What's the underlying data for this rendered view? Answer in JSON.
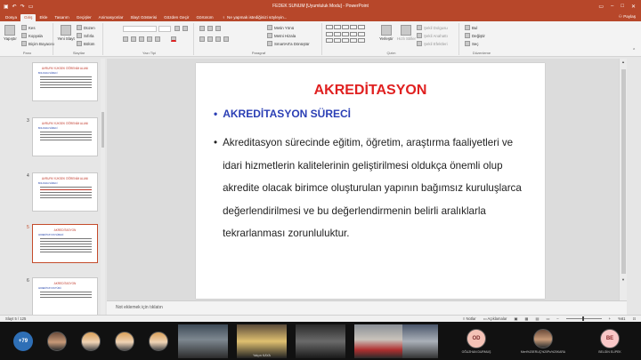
{
  "window": {
    "title": "FEDEK SUNUM [Uyumluluk Modu] - PowerPoint",
    "share_label": "Paylaş"
  },
  "tabs": [
    {
      "label": "Dosya"
    },
    {
      "label": "Giriş",
      "active": true
    },
    {
      "label": "Ekle"
    },
    {
      "label": "Tasarım"
    },
    {
      "label": "Geçişler"
    },
    {
      "label": "Animasyonlar"
    },
    {
      "label": "Slayt Gösterisi"
    },
    {
      "label": "Gözden Geçir"
    },
    {
      "label": "Görünüm"
    }
  ],
  "tell_me": "Ne yapmak istediğinizi söyleyin...",
  "ribbon": {
    "clipboard": {
      "cut": "Kes",
      "copy": "Kopyala",
      "paste": "Yapıştır",
      "format_painter": "Biçim Boyacısı",
      "label": "Pano"
    },
    "slides": {
      "new_slide": "Yeni Slayt",
      "layout": "Düzen",
      "reset": "Sıfırla",
      "section": "Bölüm",
      "label": "Slaytlar"
    },
    "font": {
      "label": "Yazı Tipi"
    },
    "paragraph": {
      "text_direction": "Metin Yönü",
      "align_text": "Metni Hizala",
      "smartart": "SmartArt'a Dönüştür",
      "label": "Paragraf"
    },
    "drawing": {
      "arrange": "Yerleştir",
      "quick_styles": "Hızlı Stiller",
      "shape_fill": "Şekil Dolgusu",
      "shape_outline": "Şekil Anahattı",
      "shape_effects": "Şekil Efektleri",
      "label": "Çizim"
    },
    "editing": {
      "find": "Bul",
      "replace": "Değiştir",
      "select": "Seç",
      "label": "Düzenleme"
    }
  },
  "thumbnails": [
    {
      "num": "",
      "title": "AVRUPA YÜKSEK ÖĞRENİM ALANI",
      "sub": "BOLOGNA SÜRECİ"
    },
    {
      "num": "3",
      "title": "AVRUPA YÜKSEK ÖĞRENİM ALANI",
      "sub": "BOLOGNA SÜRECİ"
    },
    {
      "num": "4",
      "title": "AVRUPA YÜKSEK ÖĞRENİM ALANI",
      "sub": "BOLOGNA SÜRECİ"
    },
    {
      "num": "5",
      "title": "AKREDİTASYON",
      "sub": "AKREDİTASYON SÜRECİ",
      "selected": true
    },
    {
      "num": "6",
      "title": "AKREDİTASYON",
      "sub": "AKREDİTASYON TÜRÜ"
    }
  ],
  "slide": {
    "title": "AKREDİTASYON",
    "subtitle": "AKREDİTASYON SÜRECİ",
    "body": "Akreditasyon sürecinde eğitim, öğretim, araştırma faaliyetleri ve idari hizmetlerin kalitelerinin geliştirilmesi oldukça önemli olup akredite olacak birimce oluşturulan yapının bağımsız kuruluşlarca değerlendirilmesi ve bu değerlendirmenin belirli aralıklarla tekrarlanması zorunluluktur.",
    "bullet": "•"
  },
  "notes_placeholder": "Not eklemek için tıklatın",
  "status": {
    "slide_info": "Slayt 5 / 125",
    "notes": "Notlar",
    "comments": "Açıklamalar",
    "zoom": "%61"
  },
  "participants": [
    {
      "label": "+79",
      "kind": "more"
    },
    {
      "label": "",
      "kind": "photo"
    },
    {
      "label": "",
      "kind": "photo2"
    },
    {
      "label": "",
      "kind": "photo2"
    },
    {
      "label": "",
      "kind": "photo2"
    },
    {
      "label": "",
      "kind": "video"
    },
    {
      "label": "Yalçın KAYA",
      "kind": "video"
    },
    {
      "label": "",
      "kind": "video"
    },
    {
      "label": "",
      "kind": "video"
    },
    {
      "label": "OD",
      "name": "OĞUZHAN DURMUŞ",
      "kind": "initials"
    },
    {
      "label": "",
      "name": "Mert%20ERUÇ%20Pu%20KARA",
      "kind": "photo"
    },
    {
      "label": "BE",
      "name": "BELGİN ELİPEK",
      "kind": "initials2"
    }
  ]
}
